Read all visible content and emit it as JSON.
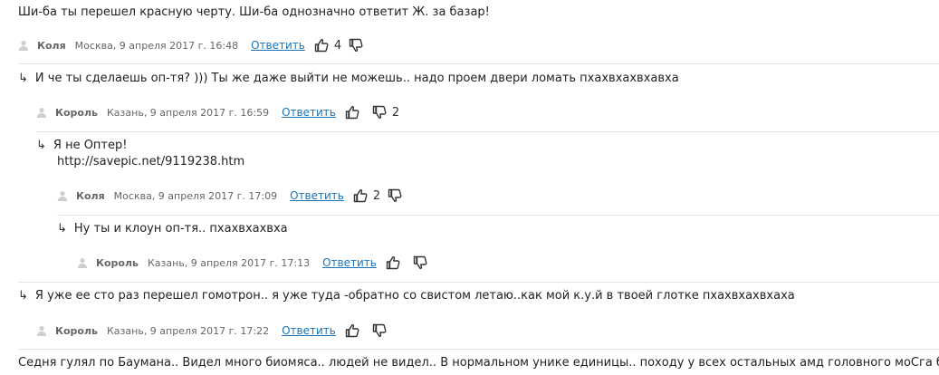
{
  "comments": [
    {
      "text": "Ши-ба ты перешел красную черту. Ши-ба однозначно ответит Ж. за базар!",
      "author": "Коля",
      "date": "Москва, 9 апреля 2017 г. 16:48",
      "reply": "Ответить",
      "likes": "4",
      "dislikes": ""
    },
    {
      "text": "И че ты сделаешь оп-тя? ))) Ты же даже выйти не можешь.. надо проем двери ломать пхахвхахвхавха",
      "author": "Король",
      "date": "Казань, 9 апреля 2017 г. 16:59",
      "reply": "Ответить",
      "likes": "",
      "dislikes": "2"
    },
    {
      "text": "Я не Оптер!",
      "text2": "http://savepic.net/9119238.htm",
      "author": "Коля",
      "date": "Москва, 9 апреля 2017 г. 17:09",
      "reply": "Ответить",
      "likes": "2",
      "dislikes": ""
    },
    {
      "text": "Ну ты и клоун оп-тя.. пхахвхахвха",
      "author": "Король",
      "date": "Казань, 9 апреля 2017 г. 17:13",
      "reply": "Ответить",
      "likes": "",
      "dislikes": ""
    },
    {
      "text": "Я уже ее сто раз перешел гомотрон.. я уже туда -обратно со свистом летаю..как мой к.у.й в твоей глотке пхахвхахвхаха",
      "author": "Король",
      "date": "Казань, 9 апреля 2017 г. 17:22",
      "reply": "Ответить",
      "likes": "",
      "dislikes": ""
    },
    {
      "text": "Седня гулял по Баумана.. Видел много биомяса.. людей не видел.. В нормальном унике единицы.. походу у всех остальных амд головного моСга б.л.я пхахвхахв"
    }
  ],
  "icons": {
    "arrow": "↳",
    "user": "user-icon",
    "like": "thumbs-up-icon",
    "dislike": "thumbs-down-icon"
  },
  "colors": {
    "reply_link": "#1a73b8",
    "meta_text": "#666666",
    "separator": "#e2e2e2"
  }
}
